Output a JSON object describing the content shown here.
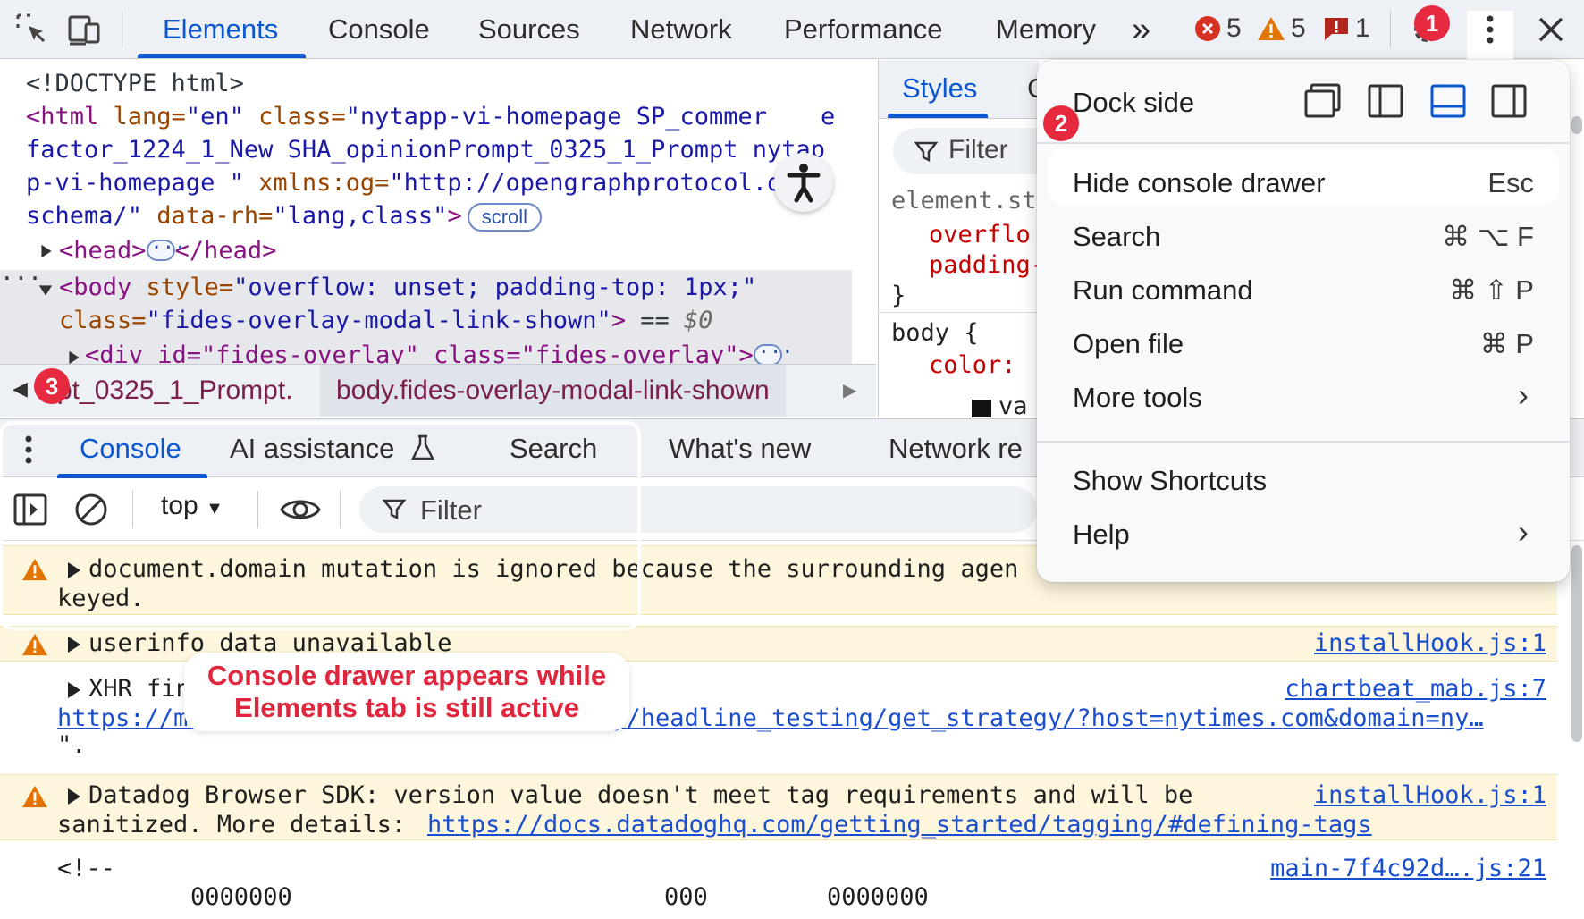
{
  "toolbar": {
    "tabs": [
      "Elements",
      "Console",
      "Sources",
      "Network",
      "Performance",
      "Memory"
    ],
    "more_tabs": "»",
    "errors": "5",
    "warnings": "5",
    "issues": "1",
    "step1": "1"
  },
  "elements": {
    "doctype": "<!DOCTYPE html>",
    "html_open": "<html",
    "html_attr1": " lang=",
    "html_val1": "\"en\"",
    "html_attr2": " class=",
    "html_val2a": "\"nytapp-vi-homepage SP_commer",
    "html_val2b": "e",
    "html_val2c": "factor_1224_1_New SHA_opinionPrompt_0325_1_Prompt nytap",
    "html_val2d": "p-vi-homepage \"",
    "html_attr3": " xmlns:og=",
    "html_val3a": "\"http://opengraphprotocol.org/",
    "html_val3b": "schema/\"",
    "html_attr4": " data-rh=",
    "html_val4": "\"lang,class\"",
    "html_close": ">",
    "scroll_badge": "scroll",
    "head_open": "<head>",
    "head_close": "</head>",
    "body_open": "<body",
    "body_attr1": " style=",
    "body_val1": "\"overflow: unset; padding-top: 1px;\"",
    "body_attr2": "class=",
    "body_val2": "\"fides-overlay-modal-link-shown\"",
    "body_close": ">",
    "body_eq": " == ",
    "body_dollar": "$0",
    "div_line": "<div id=\"fides-overlay\" class=\"fides-overlay\">"
  },
  "breadcrumbs": {
    "prev": "pt_0325_1_Prompt.",
    "selected": "body.fides-overlay-modal-link-shown",
    "step3": "3"
  },
  "styles": {
    "tab": "Styles",
    "tab_next": "C",
    "filter": "Filter",
    "rule1_sel": "element.st",
    "rule1_p1": "overflo",
    "rule1_p2": "padding-",
    "rule1_close": "}",
    "rule2_sel": "body {",
    "rule2_p1": "color:",
    "rule2_v1": "va"
  },
  "drawer": {
    "tabs": [
      "Console",
      "AI assistance",
      "Search",
      "What's new",
      "Network re"
    ],
    "context": "top",
    "filter_placeholder": "Filter"
  },
  "messages": [
    {
      "type": "warn",
      "line1": "document.domain mutation is ignored because the surrounding agen",
      "line2": "keyed."
    },
    {
      "type": "warn",
      "line1": "userinfo data unavailable",
      "source": "installHook.js:1"
    },
    {
      "type": "info",
      "line1": "XHR fin",
      "line2_link": "https://mab",
      "line2_link_b": "gy/headline_testing/get_strategy/?host=nytimes.com&domain=ny…",
      "line3": "\".",
      "source": "chartbeat_mab.js:7"
    },
    {
      "type": "warn",
      "line1": "Datadog Browser SDK: version value doesn't meet tag requirements and will be",
      "line2_prefix": "sanitized. More details: ",
      "line2_link": "https://docs.datadoghq.com/getting_started/tagging/#defining-tags",
      "source": "installHook.js:1"
    },
    {
      "type": "info",
      "line1": "<!--",
      "line2a": "0000000",
      "line2b": "000",
      "line2c": "0000000",
      "source": "main-7f4c92d….js:21"
    }
  ],
  "callout": {
    "line1": "Console drawer appears while",
    "line2": "Elements tab is still active"
  },
  "menu": {
    "dock_side": "Dock side",
    "step2": "2",
    "items": [
      {
        "label": "Hide console drawer",
        "shortcut": "Esc"
      },
      {
        "label": "Search",
        "shortcut": "⌘ ⌥ F"
      },
      {
        "label": "Run command",
        "shortcut": "⌘ ⇧ P"
      },
      {
        "label": "Open file",
        "shortcut": "⌘ P"
      },
      {
        "label": "More tools",
        "shortcut": "›"
      },
      {
        "label": "Show Shortcuts",
        "shortcut": ""
      },
      {
        "label": "Help",
        "shortcut": "›"
      }
    ]
  },
  "colors": {
    "accent": "#0b57d0",
    "error": "#d93025",
    "warning": "#e37400",
    "annotation": "#e6293e"
  }
}
